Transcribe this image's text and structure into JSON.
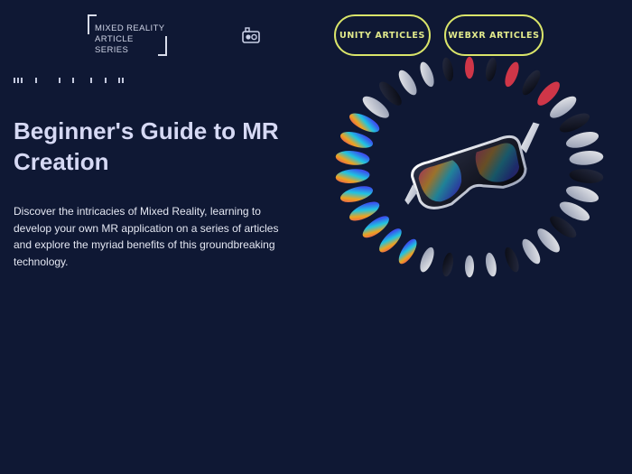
{
  "header": {
    "logo_line1": "MIXED REALITY",
    "logo_line2": "ARTICLE SERIES",
    "vr_icon": "vr-headset-icon",
    "nav": [
      {
        "label": "UNITY ARTICLES"
      },
      {
        "label": "WEBXR ARTICLES"
      }
    ],
    "accent": "#d9e46a"
  },
  "hero": {
    "title": "Beginner's Guide to MR Creation",
    "description": "Discover the intricacies of Mixed Reality, learning to develop your own MR application on a series of articles and explore the myriad benefits of this groundbreaking technology.",
    "artwork": "holographic-ring-with-mr-glasses"
  },
  "colors": {
    "background": "#0f1834",
    "title": "#d6d9f4"
  }
}
